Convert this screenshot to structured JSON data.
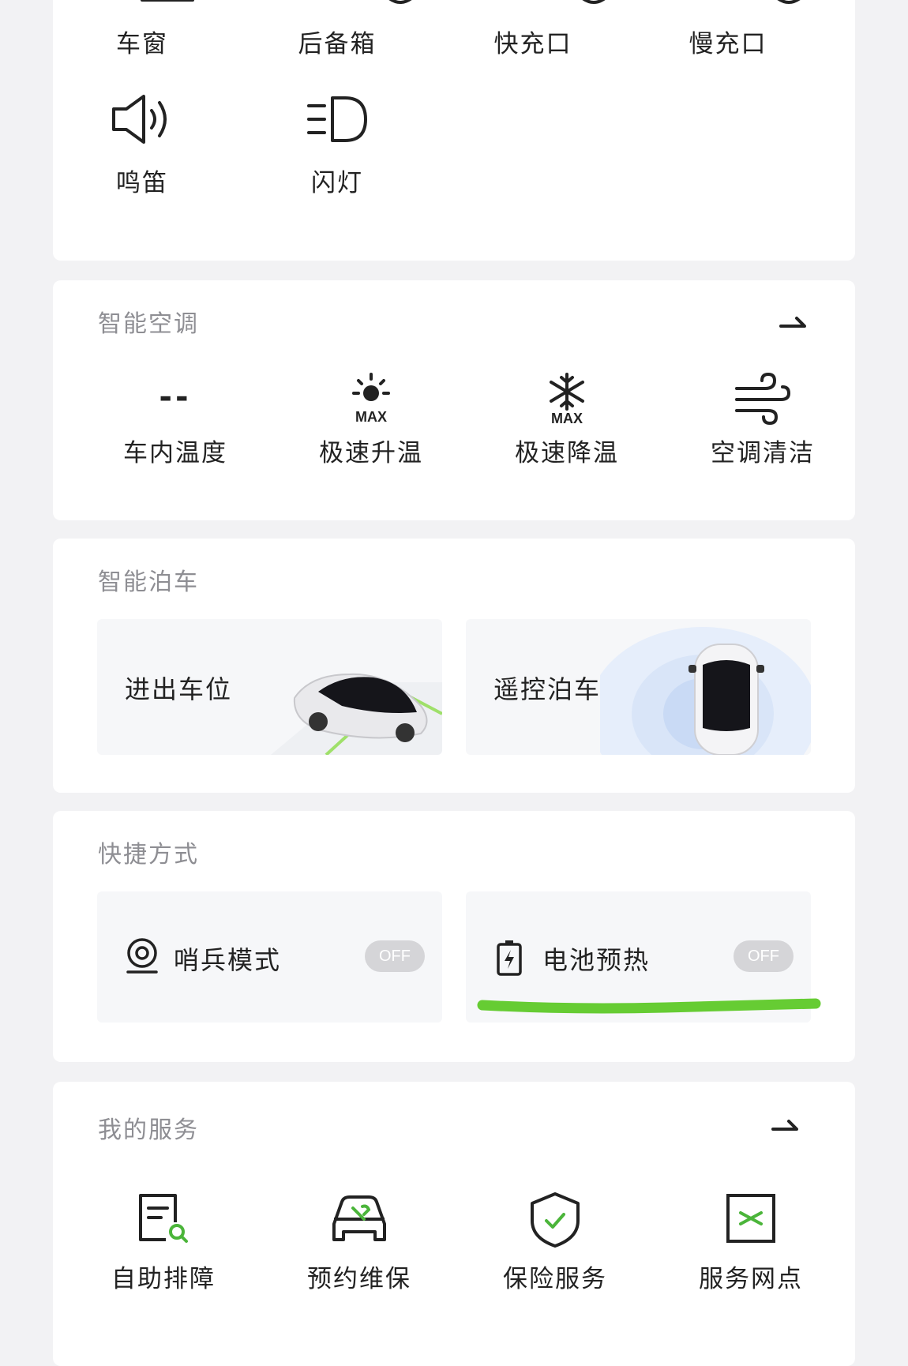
{
  "controls": {
    "row1": [
      "车窗",
      "后备箱",
      "快充口",
      "慢充口"
    ],
    "row2": [
      {
        "label": "鸣笛",
        "icon": "horn-icon"
      },
      {
        "label": "闪灯",
        "icon": "headlight-icon"
      }
    ]
  },
  "climate": {
    "title": "智能空调",
    "items": [
      {
        "value": "--",
        "label": "车内温度"
      },
      {
        "label": "极速升温",
        "icon": "sun-max-icon",
        "badge": "MAX"
      },
      {
        "label": "极速降温",
        "icon": "snowflake-max-icon",
        "badge": "MAX"
      },
      {
        "label": "空调清洁",
        "icon": "wind-icon"
      }
    ]
  },
  "parking": {
    "title": "智能泊车",
    "tiles": [
      {
        "label": "进出车位"
      },
      {
        "label": "遥控泊车"
      }
    ]
  },
  "shortcuts": {
    "title": "快捷方式",
    "items": [
      {
        "label": "哨兵模式",
        "state": "OFF",
        "icon": "sentry-camera-icon"
      },
      {
        "label": "电池预热",
        "state": "OFF",
        "icon": "battery-charge-icon"
      }
    ],
    "highlight_color": "#66cc33"
  },
  "services": {
    "title": "我的服务",
    "items": [
      {
        "label": "自助排障",
        "icon": "self-diagnosis-icon"
      },
      {
        "label": "预约维保",
        "icon": "maintenance-icon"
      },
      {
        "label": "保险服务",
        "icon": "insurance-shield-icon"
      },
      {
        "label": "服务网点",
        "icon": "service-outlet-icon"
      }
    ]
  }
}
